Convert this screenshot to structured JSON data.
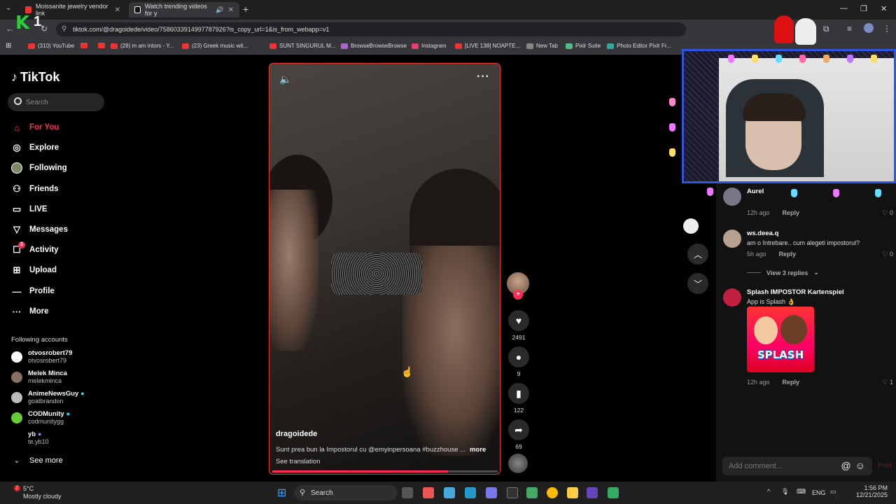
{
  "browser": {
    "tabs": [
      {
        "title": "Moissanite jewelry vendor link"
      },
      {
        "title": "Watch trending videos for y"
      }
    ],
    "url": "tiktok.com/@dragoidede/video/7586033914997787926?is_copy_url=1&is_from_webapp=v1",
    "bookmarks": [
      "(310) YouTube",
      "(28) m am intors - Y...",
      "(23) Greek music wit...",
      "SUNT SINGURUL M...",
      "BrowseBrowseBrowse",
      "Instagram",
      "[LIVE 138] NOAPTE...",
      "New Tab",
      "Pixlr Suite",
      "Photo Editor Pixlr Fr..."
    ]
  },
  "overlay": {
    "k_logo": "K",
    "k_number": "1"
  },
  "tiktok": {
    "brand": "TikTok",
    "search_placeholder": "Search",
    "nav": {
      "for_you": "For You",
      "explore": "Explore",
      "following": "Following",
      "friends": "Friends",
      "live": "LIVE",
      "messages": "Messages",
      "activity": "Activity",
      "activity_badge": "2",
      "upload": "Upload",
      "profile": "Profile",
      "more": "More"
    },
    "following_accounts_title": "Following accounts",
    "accounts": [
      {
        "name": "otvosrobert79",
        "handle": "otvosrobert79"
      },
      {
        "name": "Melek Minca",
        "handle": "melekminca"
      },
      {
        "name": "AnimeNewsGuy",
        "handle": "goatbrandon"
      },
      {
        "name": "CODMunity",
        "handle": "codmunitygg"
      },
      {
        "name": "yb",
        "handle": "te.yb10"
      }
    ],
    "see_more": "See more"
  },
  "video": {
    "author": "dragoidede",
    "caption": "Sunt prea bun la Impostorul cu @emyinpersoana #buzzhouse ...",
    "more": "more",
    "see_translation": "See translation",
    "progress": 0.78,
    "likes": "2491",
    "comments": "9",
    "saves": "122",
    "shares": "69"
  },
  "comments": [
    {
      "name": "Aurel",
      "time": "12h ago",
      "reply": "Reply",
      "likes": "0"
    },
    {
      "name": "ws.deea.q",
      "text": "am o întrebare.. cum alegeti impostorul?",
      "time": "5h ago",
      "reply": "Reply",
      "likes": "0",
      "view_replies": "View 3 replies"
    },
    {
      "name": "Splash IMPOSTOR Kartenspiel",
      "text": "App is Splash 👌",
      "image_text": "SPLASH",
      "time": "12h ago",
      "reply": "Reply",
      "likes": "1"
    }
  ],
  "add_comment_placeholder": "Add comment...",
  "post_label": "Post",
  "taskbar": {
    "weather_temp": "5°C",
    "weather_desc": "Mostly cloudy",
    "weather_badge": "2",
    "search": "Search",
    "lang": "ENG",
    "time": "1:56 PM",
    "date": "12/21/2025"
  }
}
